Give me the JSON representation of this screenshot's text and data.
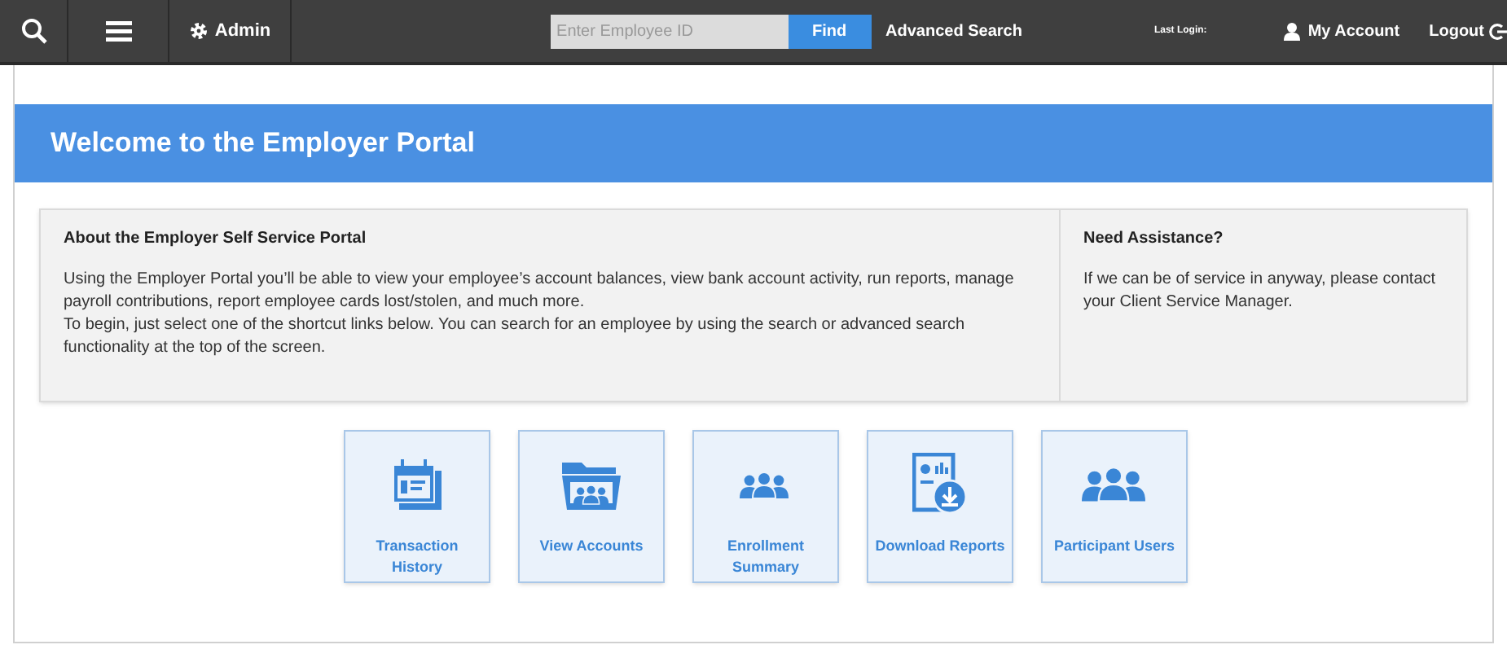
{
  "topbar": {
    "admin": "Admin",
    "search": {
      "placeholder": "Enter Employee ID"
    },
    "find": "Find",
    "advanced_search": "Advanced Search",
    "last_login": "Last Login:",
    "my_account": "My Account",
    "logout": "Logout"
  },
  "banner": {
    "title": "Welcome to the Employer Portal"
  },
  "about": {
    "title": "About the Employer Self Service Portal",
    "paragraphs": [
      "Using the Employer Portal you’ll be able to view your employee’s account balances, view bank account activity, run reports, manage payroll contributions, report employee cards lost/stolen, and much more.",
      "To begin, just select one of the shortcut links below. You can search for an employee by using the search or advanced search functionality at the top of the screen."
    ]
  },
  "assistance": {
    "title": "Need Assistance?",
    "text": "If we can be of service in anyway, please contact your Client Service Manager."
  },
  "shortcuts": [
    {
      "kind": "calendar",
      "label": "Transaction History"
    },
    {
      "kind": "folder",
      "label": "View Accounts"
    },
    {
      "kind": "group-small",
      "label": "Enrollment Summary"
    },
    {
      "kind": "report",
      "label": "Download Reports"
    },
    {
      "kind": "group",
      "label": "Participant Users"
    }
  ]
}
